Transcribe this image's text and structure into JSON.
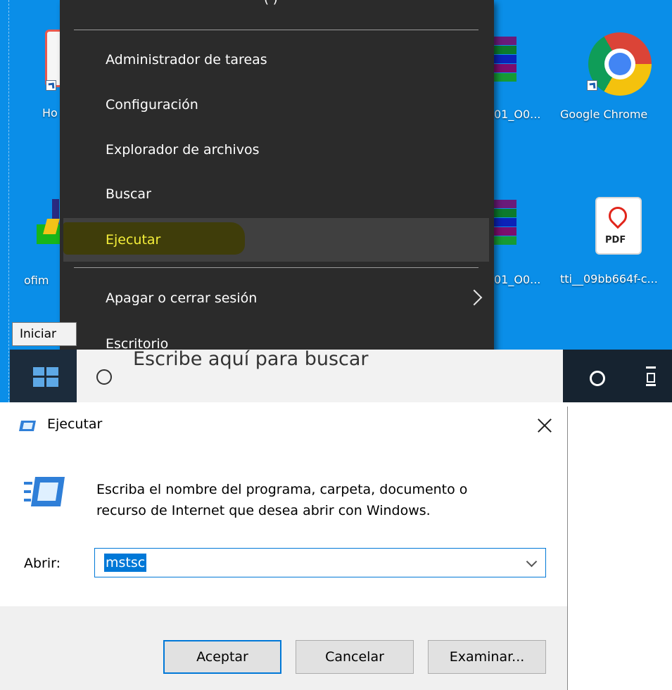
{
  "desktop": {
    "icons": [
      {
        "label": "Ho",
        "icon": "app-shortcut-icon"
      },
      {
        "label": "ofim",
        "icon": "office-shortcut-icon"
      },
      {
        "label": "01_O0...",
        "icon": "winrar-archive-icon"
      },
      {
        "label": "01_O0...",
        "icon": "winrar-archive-icon"
      },
      {
        "label": "Google Chrome",
        "icon": "chrome-icon"
      },
      {
        "label": "tti__09bb664f-c...",
        "icon": "pdf-file-icon",
        "badge": "PDF"
      }
    ]
  },
  "context_menu": {
    "items": [
      {
        "label": "Administrador de tareas"
      },
      {
        "label": "Configuración"
      },
      {
        "label": "Explorador de archivos"
      },
      {
        "label": "Buscar"
      },
      {
        "label": "Ejecutar",
        "highlighted": true
      },
      {
        "label": "Apagar o cerrar sesión",
        "submenu": true
      },
      {
        "label": "Escritorio"
      }
    ]
  },
  "taskbar": {
    "tooltip": "Iniciar",
    "search_placeholder": "Escribe aquí para buscar"
  },
  "run_dialog": {
    "title": "Ejecutar",
    "description_line1": "Escriba el nombre del programa, carpeta, documento o",
    "description_line2": "recurso de Internet que desea abrir con Windows.",
    "open_label": "Abrir:",
    "input_value": "mstsc",
    "buttons": {
      "ok": "Aceptar",
      "cancel": "Cancelar",
      "browse": "Examinar..."
    }
  },
  "colors": {
    "desktop": "#0a8ee8",
    "menu_bg": "#2b2b2b",
    "highlight_text": "#f5ef3a",
    "accent": "#0078d7"
  }
}
